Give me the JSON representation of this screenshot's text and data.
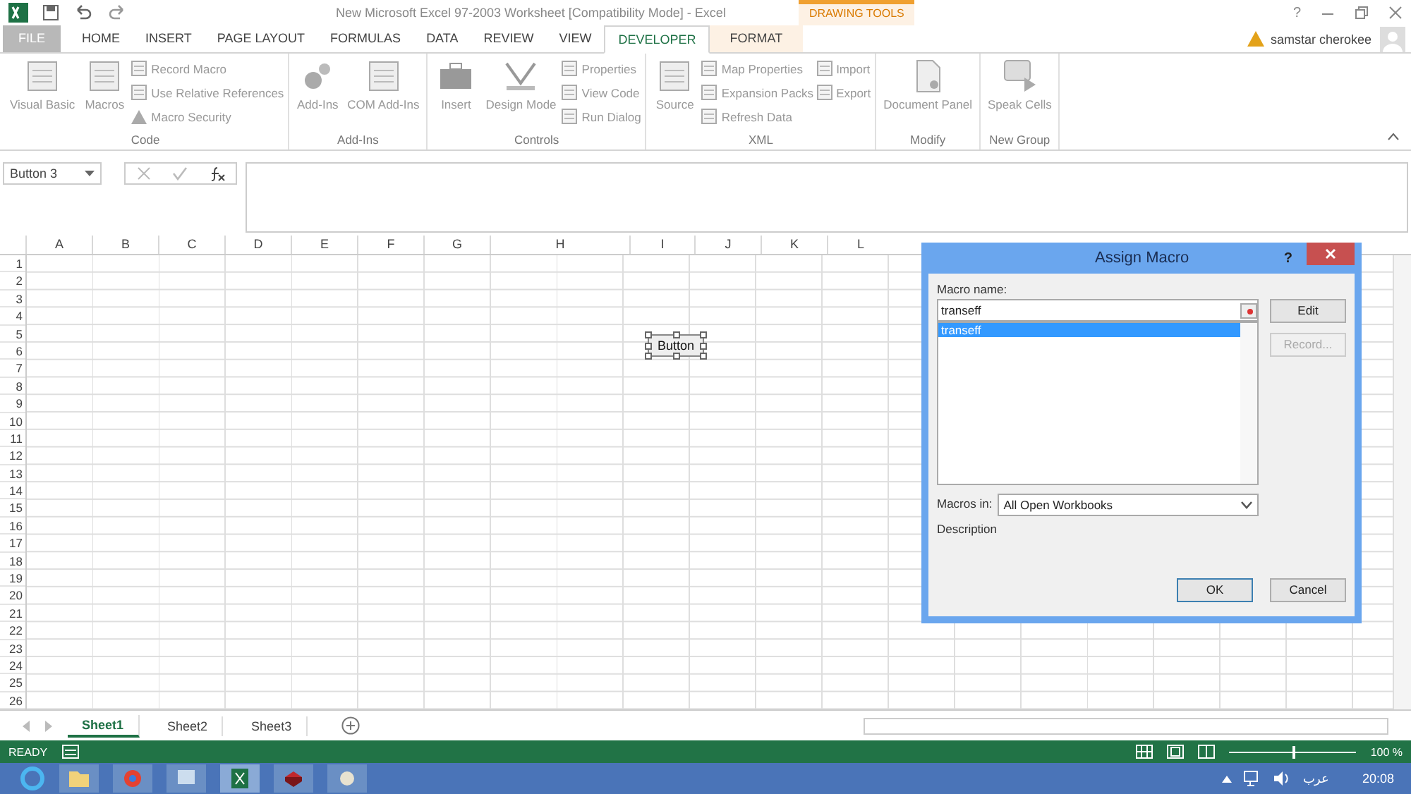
{
  "window": {
    "help": "?",
    "title": "New Microsoft Excel 97-2003 Worksheet  [Compatibility Mode] - Excel",
    "context_tab_group": "DRAWING TOOLS",
    "user": "samstar cherokee"
  },
  "tabs": [
    {
      "label": "FILE",
      "selected": false,
      "kind": "file"
    },
    {
      "label": "HOME",
      "selected": false,
      "kind": "tab"
    },
    {
      "label": "INSERT",
      "selected": false,
      "kind": "tab"
    },
    {
      "label": "PAGE LAYOUT",
      "selected": false,
      "kind": "tab"
    },
    {
      "label": "FORMULAS",
      "selected": false,
      "kind": "tab"
    },
    {
      "label": "DATA",
      "selected": false,
      "kind": "tab"
    },
    {
      "label": "REVIEW",
      "selected": false,
      "kind": "tab"
    },
    {
      "label": "VIEW",
      "selected": false,
      "kind": "tab"
    },
    {
      "label": "DEVELOPER",
      "selected": true,
      "kind": "tab"
    },
    {
      "label": "FORMAT",
      "selected": false,
      "kind": "context"
    }
  ],
  "ribbon": [
    {
      "name": "Code",
      "large": [
        {
          "label": "Visual Basic"
        },
        {
          "label": "Macros"
        }
      ],
      "small": [
        {
          "label": "Record Macro"
        },
        {
          "label": "Use Relative References"
        },
        {
          "label": "Macro Security"
        }
      ]
    },
    {
      "name": "Add-Ins",
      "large": [
        {
          "label": "Add-Ins"
        },
        {
          "label": "COM Add-Ins"
        }
      ]
    },
    {
      "name": "Controls",
      "large": [
        {
          "label": "Insert"
        },
        {
          "label": "Design Mode"
        }
      ],
      "small": [
        {
          "label": "Properties"
        },
        {
          "label": "View Code"
        },
        {
          "label": "Run Dialog"
        }
      ]
    },
    {
      "name": "XML",
      "large": [
        {
          "label": "Source"
        }
      ],
      "small": [
        {
          "label": "Map Properties"
        },
        {
          "label": "Expansion Packs"
        },
        {
          "label": "Refresh Data"
        }
      ],
      "small2": [
        {
          "label": "Import"
        },
        {
          "label": "Export"
        }
      ]
    },
    {
      "name": "Modify",
      "large": [
        {
          "label": "Document Panel"
        }
      ]
    },
    {
      "name": "New Group",
      "large": [
        {
          "label": "Speak Cells"
        }
      ]
    }
  ],
  "name_box": "Button 3",
  "columns": [
    "A",
    "B",
    "C",
    "D",
    "E",
    "F",
    "G",
    "H",
    "I",
    "J",
    "K",
    "L"
  ],
  "rows": [
    "1",
    "2",
    "3",
    "4",
    "5",
    "6",
    "7",
    "8",
    "9",
    "10",
    "11",
    "12",
    "13",
    "14",
    "15",
    "16",
    "17",
    "18",
    "19",
    "20",
    "21",
    "22",
    "23",
    "24",
    "25",
    "26"
  ],
  "form_button": {
    "label": "Button"
  },
  "dialog": {
    "title": "Assign Macro",
    "help": "?",
    "macro_name_label": "Macro name:",
    "macro_name": "transeff",
    "macros": [
      {
        "label": "transeff",
        "selected": true
      }
    ],
    "macros_in_label": "Macros in:",
    "macros_in": "All Open Workbooks",
    "description_label": "Description",
    "buttons": [
      {
        "label": "Edit",
        "disabled": false
      },
      {
        "label": "Record...",
        "disabled": true
      }
    ],
    "ok": "OK",
    "cancel": "Cancel"
  },
  "sheets": [
    {
      "label": "Sheet1",
      "selected": true
    },
    {
      "label": "Sheet2",
      "selected": false
    },
    {
      "label": "Sheet3",
      "selected": false
    }
  ],
  "status": {
    "mode": "READY",
    "zoom": "100 %",
    "level": 0.5
  },
  "taskbar": {
    "language": "عرب",
    "time": "20:08"
  }
}
